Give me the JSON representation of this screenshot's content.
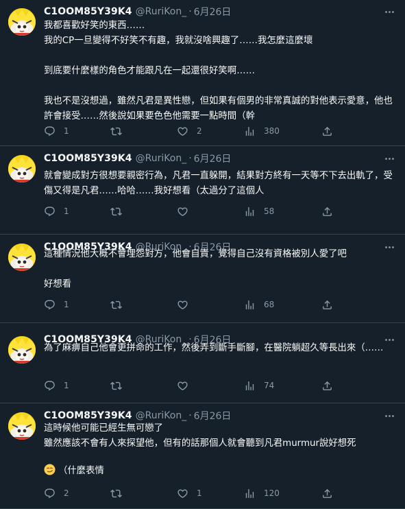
{
  "colors": {
    "background": "#15202b",
    "text": "#f7f9f9",
    "secondary": "#8b98a5",
    "divider": "#38444d",
    "avatar_yellow": "#ffd900"
  },
  "tweets": [
    {
      "display_name": "C1OOM85Y39K4",
      "handle": "@RuriKon_",
      "separator": "·",
      "date": "6月26日",
      "text": "我都喜歡好笑的東西……\n我的CP一旦變得不好笑不有趣，我就沒啥興趣了……我怎麼這麼壞\n\n到底要什麼樣的角色才能跟凡在一起還很好笑啊……\n\n我也不是沒想過，雖然凡君是異性戀，但如果有個男的非常真誠的對他表示愛意，他也許會接受……然後說如果要色色他需要一點時間（幹",
      "replies": "1",
      "retweets": "",
      "likes": "2",
      "views": "380"
    },
    {
      "display_name": "C1OOM85Y39K4",
      "handle": "@RuriKon_",
      "separator": "·",
      "date": "6月26日",
      "text": "就會變成對方很想要親密行為，凡君一直躲開，結果對方終有一天等不下去出軌了，受傷又得是凡君……哈哈……我好想看（太過分了這個人",
      "replies": "1",
      "retweets": "",
      "likes": "",
      "views": "58"
    },
    {
      "display_name": "C1OOM85Y39K4",
      "handle": "@RuriKon_",
      "separator": "·",
      "date": "6月26日",
      "text": "這種情況他大概不會埋怨對方，他會自責，覺得自己沒有資格被別人愛了吧\n\n好想看",
      "replies": "1",
      "retweets": "",
      "likes": "",
      "views": "68"
    },
    {
      "display_name": "C1OOM85Y39K4",
      "handle": "@RuriKon_",
      "separator": "·",
      "date": "6月26日",
      "text": "為了麻痹自己他會更拼命的工作，然後弄到斷手斷腳，在醫院躺超久等長出來（……",
      "replies": "1",
      "retweets": "",
      "likes": "",
      "views": "74"
    },
    {
      "display_name": "C1OOM85Y39K4",
      "handle": "@RuriKon_",
      "separator": "·",
      "date": "6月26日",
      "text": "這時候他可能已經生無可戀了\n雖然應該不會有人來探望他，但有的話那個人就會聽到凡君murmur說好想死",
      "emoji_line": "（什麼表情",
      "emoji_icon": "smirk-face-emoji",
      "replies": "2",
      "retweets": "",
      "likes": "1",
      "views": "120"
    }
  ]
}
